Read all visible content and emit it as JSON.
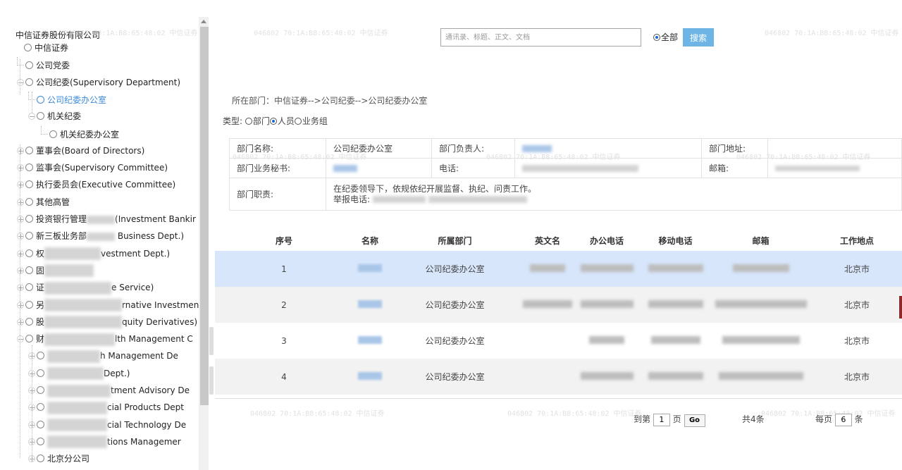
{
  "tree": {
    "root": "中信证券股份有限公司",
    "items": [
      {
        "label": "中信证券",
        "level": 0,
        "expander": "minus"
      },
      {
        "label": "公司党委",
        "level": 1,
        "expander": "line"
      },
      {
        "label": "公司纪委(Supervisory Department)",
        "level": 1,
        "expander": "minus"
      },
      {
        "label": "公司纪委办公室",
        "level": 2,
        "expander": "line",
        "selected": true
      },
      {
        "label": "机关纪委",
        "level": 2,
        "expander": "minus"
      },
      {
        "label": "机关纪委办公室",
        "level": 3,
        "expander": "line"
      },
      {
        "label": "董事会(Board of Directors)",
        "level": 1,
        "expander": "plus"
      },
      {
        "label": "监事会(Supervisory Committee)",
        "level": 1,
        "expander": "plus"
      },
      {
        "label": "执行委员会(Executive Committee)",
        "level": 1,
        "expander": "plus"
      },
      {
        "label": "其他高管",
        "level": 1,
        "expander": "plus"
      },
      {
        "label": "投资银行管理",
        "suffix": "(Investment Bankir",
        "level": 1,
        "expander": "plus"
      },
      {
        "label": "新三板业务部",
        "suffix": " Business Dept.)",
        "level": 1,
        "expander": "plus"
      },
      {
        "label": "权",
        "suffix": "vestment Dept.)",
        "level": 1,
        "expander": "plus"
      },
      {
        "label": "固",
        "suffix": "",
        "level": 1,
        "expander": "plus"
      },
      {
        "label": "证",
        "suffix": "e Service)",
        "level": 1,
        "expander": "plus"
      },
      {
        "label": "另",
        "suffix": "rnative Investment",
        "level": 1,
        "expander": "plus"
      },
      {
        "label": "股",
        "suffix": "quity Derivatives)",
        "level": 1,
        "expander": "plus"
      },
      {
        "label": "财",
        "suffix": "lth Management C",
        "level": 1,
        "expander": "minus"
      },
      {
        "label": "",
        "suffix": "h Management De",
        "level": 2,
        "expander": "plus"
      },
      {
        "label": "",
        "suffix": "Dept.)",
        "level": 2,
        "expander": "plus"
      },
      {
        "label": "",
        "suffix": "tment Advisory De",
        "level": 2,
        "expander": "plus"
      },
      {
        "label": "",
        "suffix": "cial Products Dept",
        "level": 2,
        "expander": "plus"
      },
      {
        "label": "",
        "suffix": "cial Technology De",
        "level": 2,
        "expander": "plus"
      },
      {
        "label": "",
        "suffix": "tions Managemer",
        "level": 2,
        "expander": "plus"
      },
      {
        "label": "北京分公司",
        "level": 2,
        "expander": "plus"
      }
    ]
  },
  "search": {
    "placeholder": "通讯录、标题、正文、文档",
    "scope_label": "全部",
    "button_label": "搜索"
  },
  "breadcrumb": "所在部门：中信证券-->公司纪委-->公司纪委办公室",
  "type_filter": {
    "label": "类型:",
    "options": [
      {
        "label": "部门",
        "checked": false
      },
      {
        "label": "人员",
        "checked": true
      },
      {
        "label": "业务组",
        "checked": false
      }
    ]
  },
  "dept_info": {
    "name_label": "部门名称:",
    "name_value": "公司纪委办公室",
    "head_label": "部门负责人:",
    "address_label": "部门地址:",
    "secretary_label": "部门业务秘书:",
    "phone_label": "电话:",
    "email_label": "邮箱:",
    "duty_label": "部门职责:",
    "duty_line1": "在纪委领导下，依规依纪开展监督、执纪、问责工作。",
    "duty_line2": "举报电话:"
  },
  "staff_table": {
    "headers": [
      "序号",
      "名称",
      "所属部门",
      "英文名",
      "办公电话",
      "移动电话",
      "邮箱",
      "工作地点"
    ],
    "rows": [
      {
        "index": "1",
        "department": "公司纪委办公室",
        "location": "北京市"
      },
      {
        "index": "2",
        "department": "公司纪委办公室",
        "location": "北京市"
      },
      {
        "index": "3",
        "department": "公司纪委办公室",
        "location": "北京市"
      },
      {
        "index": "4",
        "department": "公司纪委办公室",
        "location": "北京市"
      }
    ]
  },
  "pager": {
    "goto_prefix": "到第",
    "page_value": "1",
    "goto_suffix": "页",
    "go_label": "Go",
    "total_text": "共4条",
    "per_page_prefix": "每页",
    "per_page_value": "6",
    "per_page_suffix": "条"
  },
  "watermark": "046802  70:1A:B8:65:48:02  中信证券"
}
